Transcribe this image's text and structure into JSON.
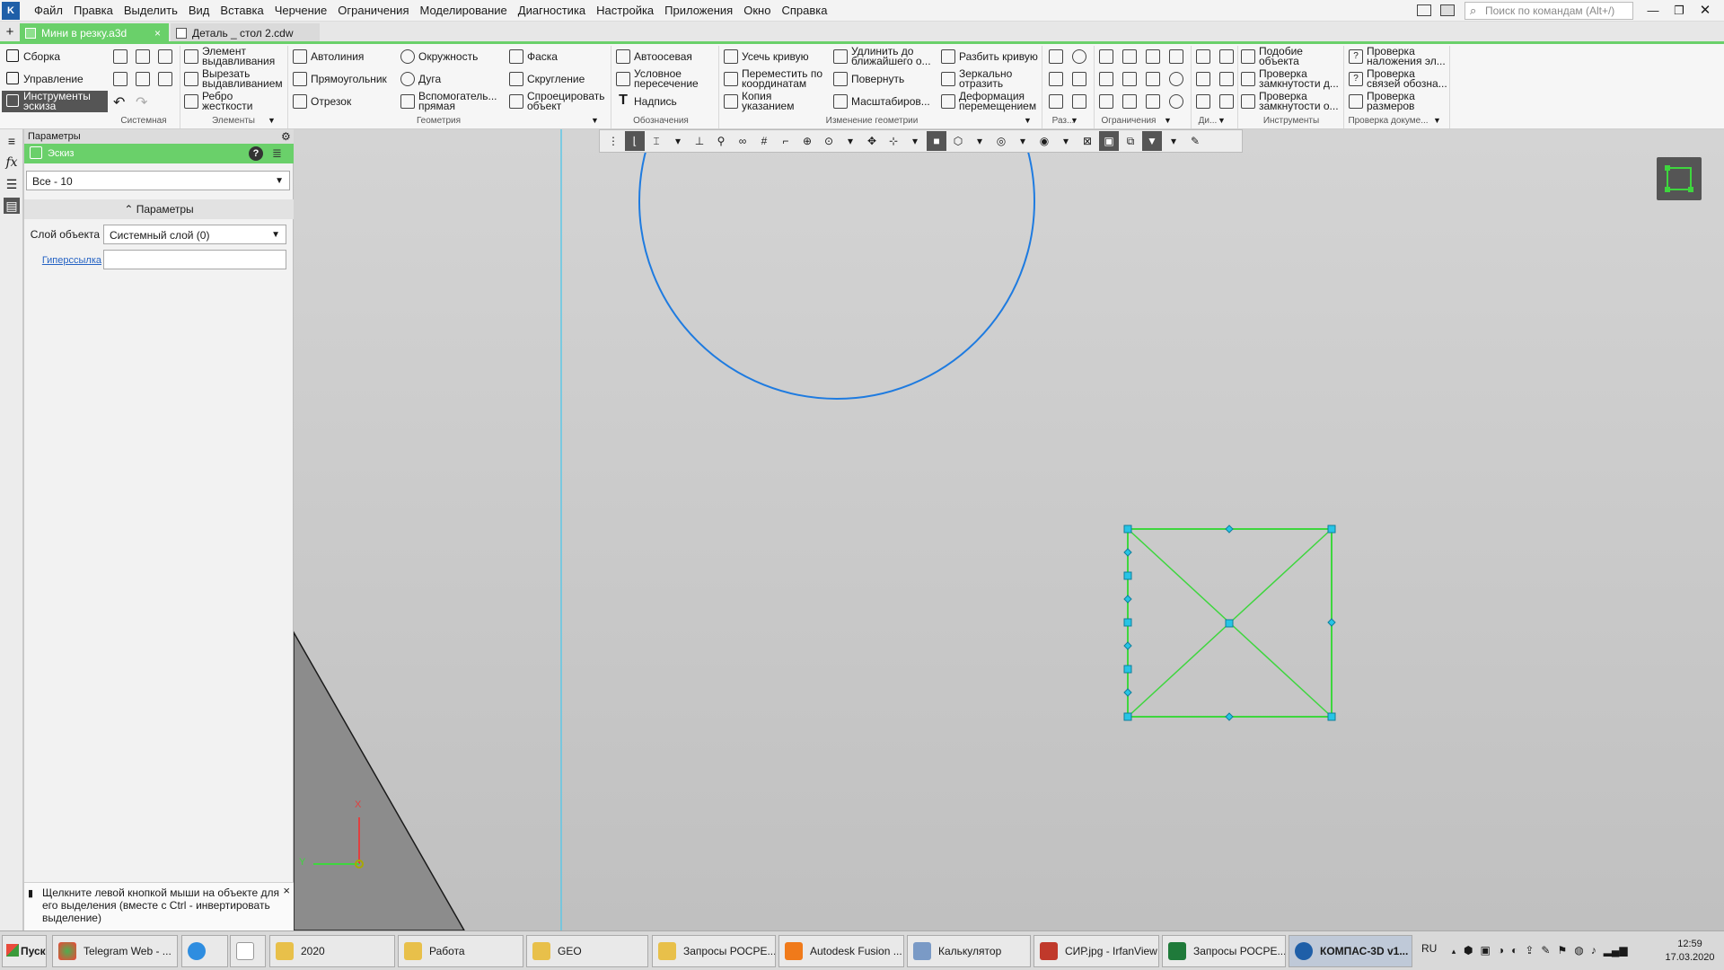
{
  "menu": [
    "Файл",
    "Правка",
    "Выделить",
    "Вид",
    "Вставка",
    "Черчение",
    "Ограничения",
    "Моделирование",
    "Диагностика",
    "Настройка",
    "Приложения",
    "Окно",
    "Справка"
  ],
  "search": {
    "placeholder": "Поиск по командам (Alt+/)"
  },
  "tabs": [
    {
      "label": "Мини в резку.a3d",
      "close": "×"
    },
    {
      "label": "Деталь _ стол 2.cdw"
    }
  ],
  "ribbon": {
    "modes": [
      "Сборка",
      "Управление",
      "Инструменты эскиза"
    ],
    "elements": [
      "Элемент выдавливания",
      "Вырезать выдавливанием",
      "Ребро жесткости"
    ],
    "geometry": [
      "Автолиния",
      "Прямоугольник",
      "Отрезок",
      "Окружность",
      "Дуга",
      "Вспомогатель... прямая",
      "Фаска",
      "Скругление",
      "Спроецировать объект"
    ],
    "notations": [
      "Автоосевая",
      "Условное пересечение",
      "Надпись"
    ],
    "edit": [
      "Усечь кривую",
      "Переместить по координатам",
      "Копия указанием",
      "Удлинить до ближайшего о...",
      "Повернуть",
      "Масштабиров...",
      "Разбить кривую",
      "Зеркально отразить",
      "Деформация перемещением"
    ],
    "tools": [
      "Подобие объекта",
      "Проверка замкнутости д...",
      "Проверка замкнутости о..."
    ],
    "doccheck": [
      "Проверка наложения эл...",
      "Проверка связей обозна...",
      "Проверка размеров"
    ],
    "group_titles": [
      "Системная",
      "Элементы",
      "Геометрия",
      "Обозначения",
      "Изменение геометрии",
      "Раз...",
      "Ограничения",
      "Ди...",
      "Инструменты",
      "Проверка докуме..."
    ]
  },
  "panel": {
    "title": "Параметры",
    "sub": "Эскиз",
    "filter": "Все - 10",
    "section": "Параметры",
    "layer_label": "Слой объекта",
    "layer_value": "Системный слой (0)",
    "hyperlink_label": "Гиперссылка",
    "hint": "Щелкните левой кнопкой мыши на объекте для его выделения (вместе с Ctrl - инвертировать выделение)"
  },
  "axes": {
    "x": "X",
    "y": "Y"
  },
  "colors": {
    "accent": "#6ad06a",
    "sketch_blue": "#1e7be0",
    "selected_green": "#3ed63e",
    "handle_cyan": "#27c4e6"
  },
  "taskbar": {
    "start": "Пуск",
    "items": [
      "Telegram Web - ...",
      "",
      "",
      "2020",
      "Работа",
      "GEO",
      "Запросы РОСРЕ...",
      "Autodesk Fusion ...",
      "Калькулятор",
      "СИР.jpg - IrfanView",
      "Запросы РОСРЕ...",
      "КОМПАС-3D v1..."
    ],
    "lang": "RU",
    "time": "12:59",
    "date": "17.03.2020"
  }
}
